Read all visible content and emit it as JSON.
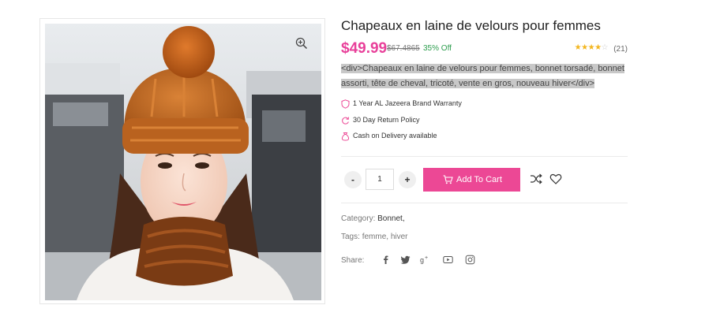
{
  "product": {
    "title": "Chapeaux en laine de velours pour femmes",
    "price": "$49.99",
    "old_price": "$67.4865",
    "discount": "35% Off",
    "rating": 4,
    "rating_max": 5,
    "reviews": "(21)",
    "description_line1": "<div>Chapeaux en laine de velours pour femmes, bonnet torsadé, bonnet",
    "description_line2": "assorti, tête de cheval, tricoté, vente en gros, nouveau hiver</div>"
  },
  "features": [
    {
      "icon": "shield-icon",
      "label": "1 Year AL Jazeera Brand Warranty"
    },
    {
      "icon": "refresh-icon",
      "label": "30 Day Return Policy"
    },
    {
      "icon": "money-bag-icon",
      "label": "Cash on Delivery available"
    }
  ],
  "cart": {
    "minus_label": "-",
    "plus_label": "+",
    "quantity": "1",
    "add_label": "Add To Cart"
  },
  "meta": {
    "category_label": "Category:",
    "category_value": "Bonnet,",
    "tags_label": "Tags:",
    "tags": [
      "femme,",
      "hiver"
    ],
    "share_label": "Share:"
  },
  "share_icons": [
    "facebook-icon",
    "twitter-icon",
    "google-plus-icon",
    "youtube-icon",
    "instagram-icon"
  ],
  "colors": {
    "accent": "#ec4895",
    "price": "#e8409a",
    "discount": "#2e9e4f",
    "star": "#f3b61f",
    "selection": "#c8c8c8"
  }
}
